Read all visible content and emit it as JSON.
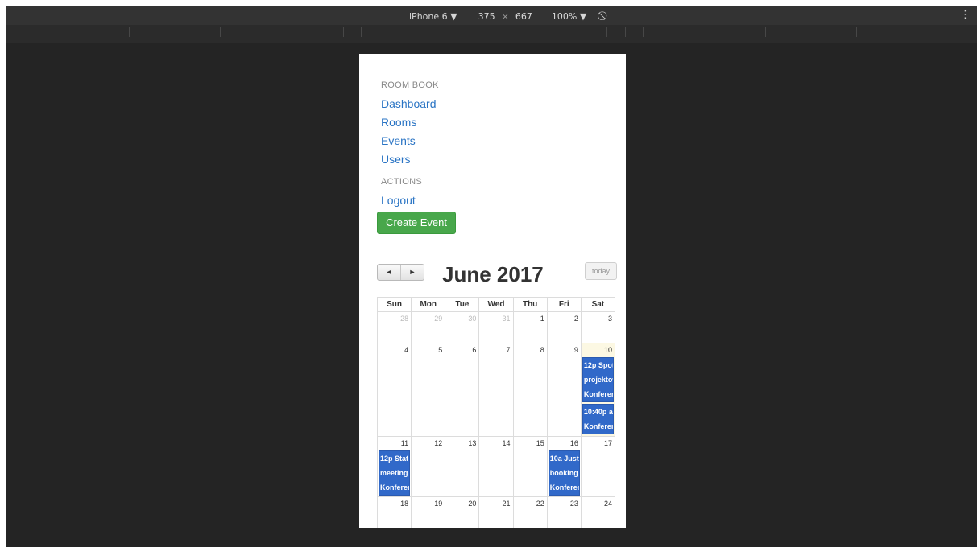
{
  "devtools": {
    "device": "iPhone 6",
    "width": "375",
    "times": "×",
    "height": "667",
    "zoom": "100%",
    "menu_icon": "vertical-dots-icon"
  },
  "sidebar": {
    "header1": "ROOM BOOK",
    "links": [
      "Dashboard",
      "Rooms",
      "Events",
      "Users"
    ],
    "header2": "ACTIONS",
    "logout": "Logout",
    "create_event": "Create Event"
  },
  "calendar": {
    "prev_icon": "◄",
    "next_icon": "►",
    "title": "June 2017",
    "today_label": "today",
    "weekdays": [
      "Sun",
      "Mon",
      "Tue",
      "Wed",
      "Thu",
      "Fri",
      "Sat"
    ],
    "weeks": [
      [
        "28",
        "29",
        "30",
        "31",
        "1",
        "2",
        "3"
      ],
      [
        "4",
        "5",
        "6",
        "7",
        "8",
        "9",
        "10"
      ],
      [
        "11",
        "12",
        "13",
        "14",
        "15",
        "16",
        "17"
      ],
      [
        "18",
        "19",
        "20",
        "21",
        "22",
        "23",
        "24"
      ]
    ],
    "events": {
      "sat10_a": [
        "12p Spot",
        "projektow",
        "Konferen"
      ],
      "sat10_b": [
        "10:40p a",
        "Konferen"
      ],
      "sun11": [
        "12p Stat",
        "meeting",
        "Konferen"
      ],
      "fri16": [
        "10a Just",
        "booking",
        "Konferen"
      ]
    },
    "colors": {
      "event": "#3169c9",
      "today_bg": "#fcf8e3",
      "button_green": "#48a74b",
      "link": "#2a74c4"
    }
  }
}
